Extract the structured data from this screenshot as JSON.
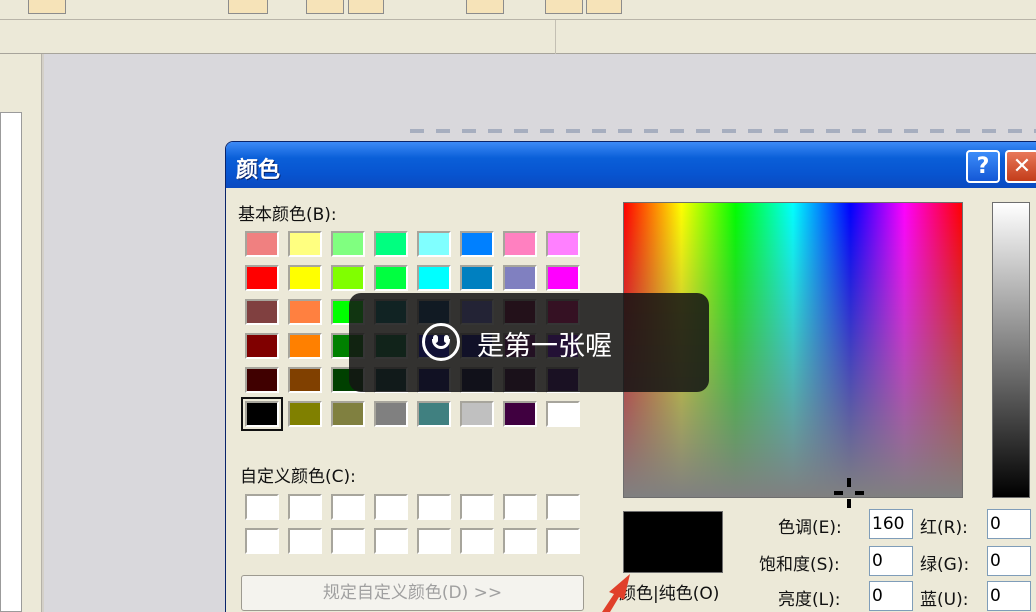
{
  "dialog": {
    "title": "颜色",
    "help_label": "?",
    "close_label": "✕",
    "basic_colors_label": "基本颜色(B):",
    "custom_colors_label": "自定义颜色(C):",
    "define_button_label": "规定自定义颜色(D) >>",
    "color_solid_label": "颜色|纯色(O)",
    "basic_colors": [
      "#f08080",
      "#ffff80",
      "#80ff80",
      "#00ff80",
      "#80ffff",
      "#0080ff",
      "#ff80c0",
      "#ff80ff",
      "#ff0000",
      "#ffff00",
      "#80ff00",
      "#00ff40",
      "#00ffff",
      "#0080c0",
      "#8080c0",
      "#ff00ff",
      "#804040",
      "#ff8040",
      "#00ff00",
      "#008080",
      "#004080",
      "#8080ff",
      "#800040",
      "#ff0080",
      "#800000",
      "#ff8000",
      "#008000",
      "#008040",
      "#0000ff",
      "#0000a0",
      "#800080",
      "#8000ff",
      "#400000",
      "#804000",
      "#004000",
      "#004040",
      "#000080",
      "#000040",
      "#400040",
      "#400080",
      "#000000",
      "#808000",
      "#808040",
      "#808080",
      "#408080",
      "#c0c0c0",
      "#400040",
      "#ffffff"
    ],
    "selected_color": "#000000",
    "fields": {
      "hue_label": "色调(E):",
      "hue_value": "160",
      "sat_label": "饱和度(S):",
      "sat_value": "0",
      "lum_label": "亮度(L):",
      "lum_value": "0",
      "red_label": "红(R):",
      "red_value": "0",
      "green_label": "绿(G):",
      "green_value": "0",
      "blue_label": "蓝(U):",
      "blue_value": "0"
    }
  },
  "toast": {
    "icon": "smiley-icon",
    "text": "是第一张喔"
  },
  "colors": {
    "titlebar": "#0a5fd8",
    "dialog_bg": "#ece9d8",
    "toast_bg": "#141414",
    "arrow": "#e0402a"
  }
}
